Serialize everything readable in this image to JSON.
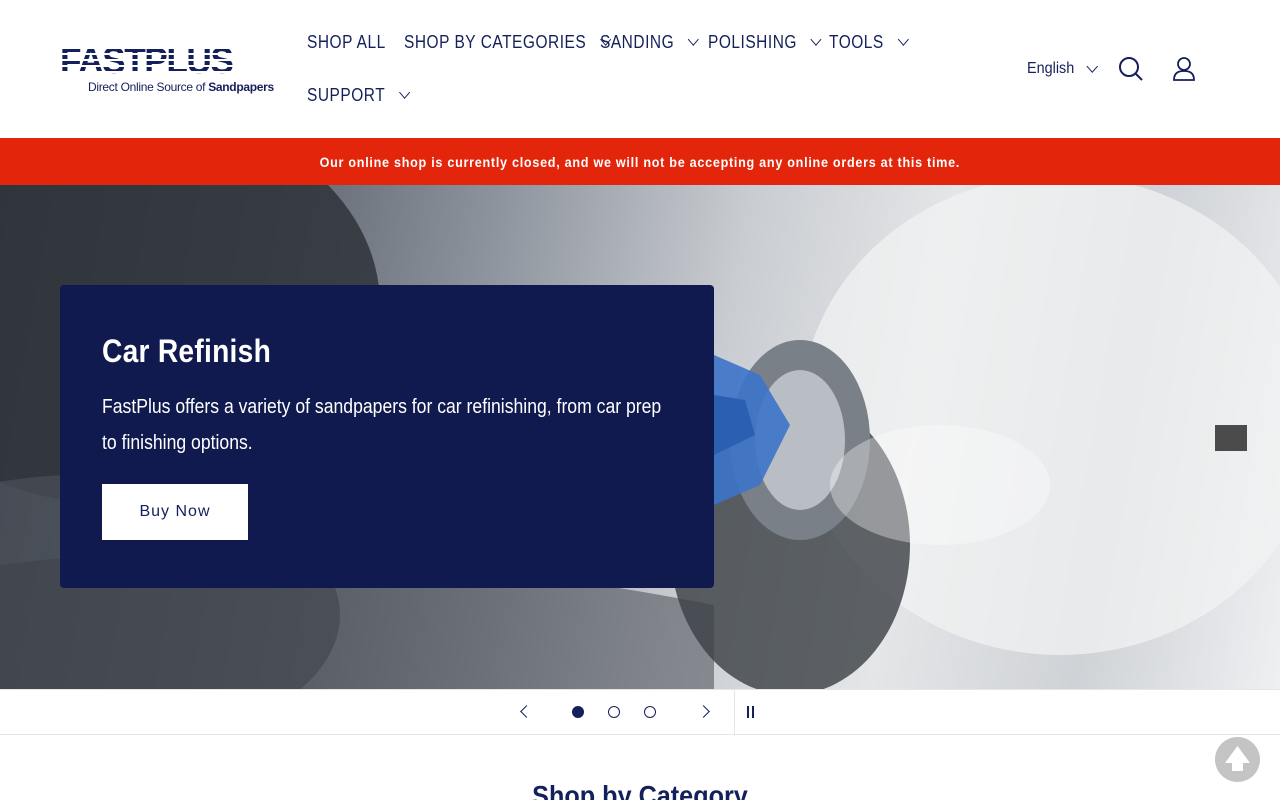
{
  "brand": {
    "name": "FASTPLUS",
    "tagline_prefix": "Direct Online Source of ",
    "tagline_emphasis": "Sandpapers"
  },
  "nav": {
    "items": [
      {
        "label": "SHOP ALL"
      },
      {
        "label": "SHOP BY CATEGORIES"
      },
      {
        "label": "SANDING"
      },
      {
        "label": "POLISHING"
      },
      {
        "label": "TOOLS"
      },
      {
        "label": "SUPPORT"
      }
    ]
  },
  "header": {
    "language": "English",
    "icons": [
      "search-icon",
      "account-icon"
    ]
  },
  "announcement": {
    "text": "Our online shop is currently closed, and we will not be accepting any online orders at this time.",
    "color": "#e3260b"
  },
  "hero": {
    "title": "Car Refinish",
    "text": "FastPlus offers a variety of sandpapers for car refinishing, from car prep to finishing options.",
    "button_label": "Buy Now",
    "card_color": "#111a4e"
  },
  "slider": {
    "slides": 3,
    "active_slide": 1,
    "icons": [
      "chevron-left-icon",
      "chevron-right-icon",
      "pause-icon"
    ]
  },
  "section": {
    "title": "Shop by Category"
  },
  "colors": {
    "brand_navy": "#14205a"
  }
}
